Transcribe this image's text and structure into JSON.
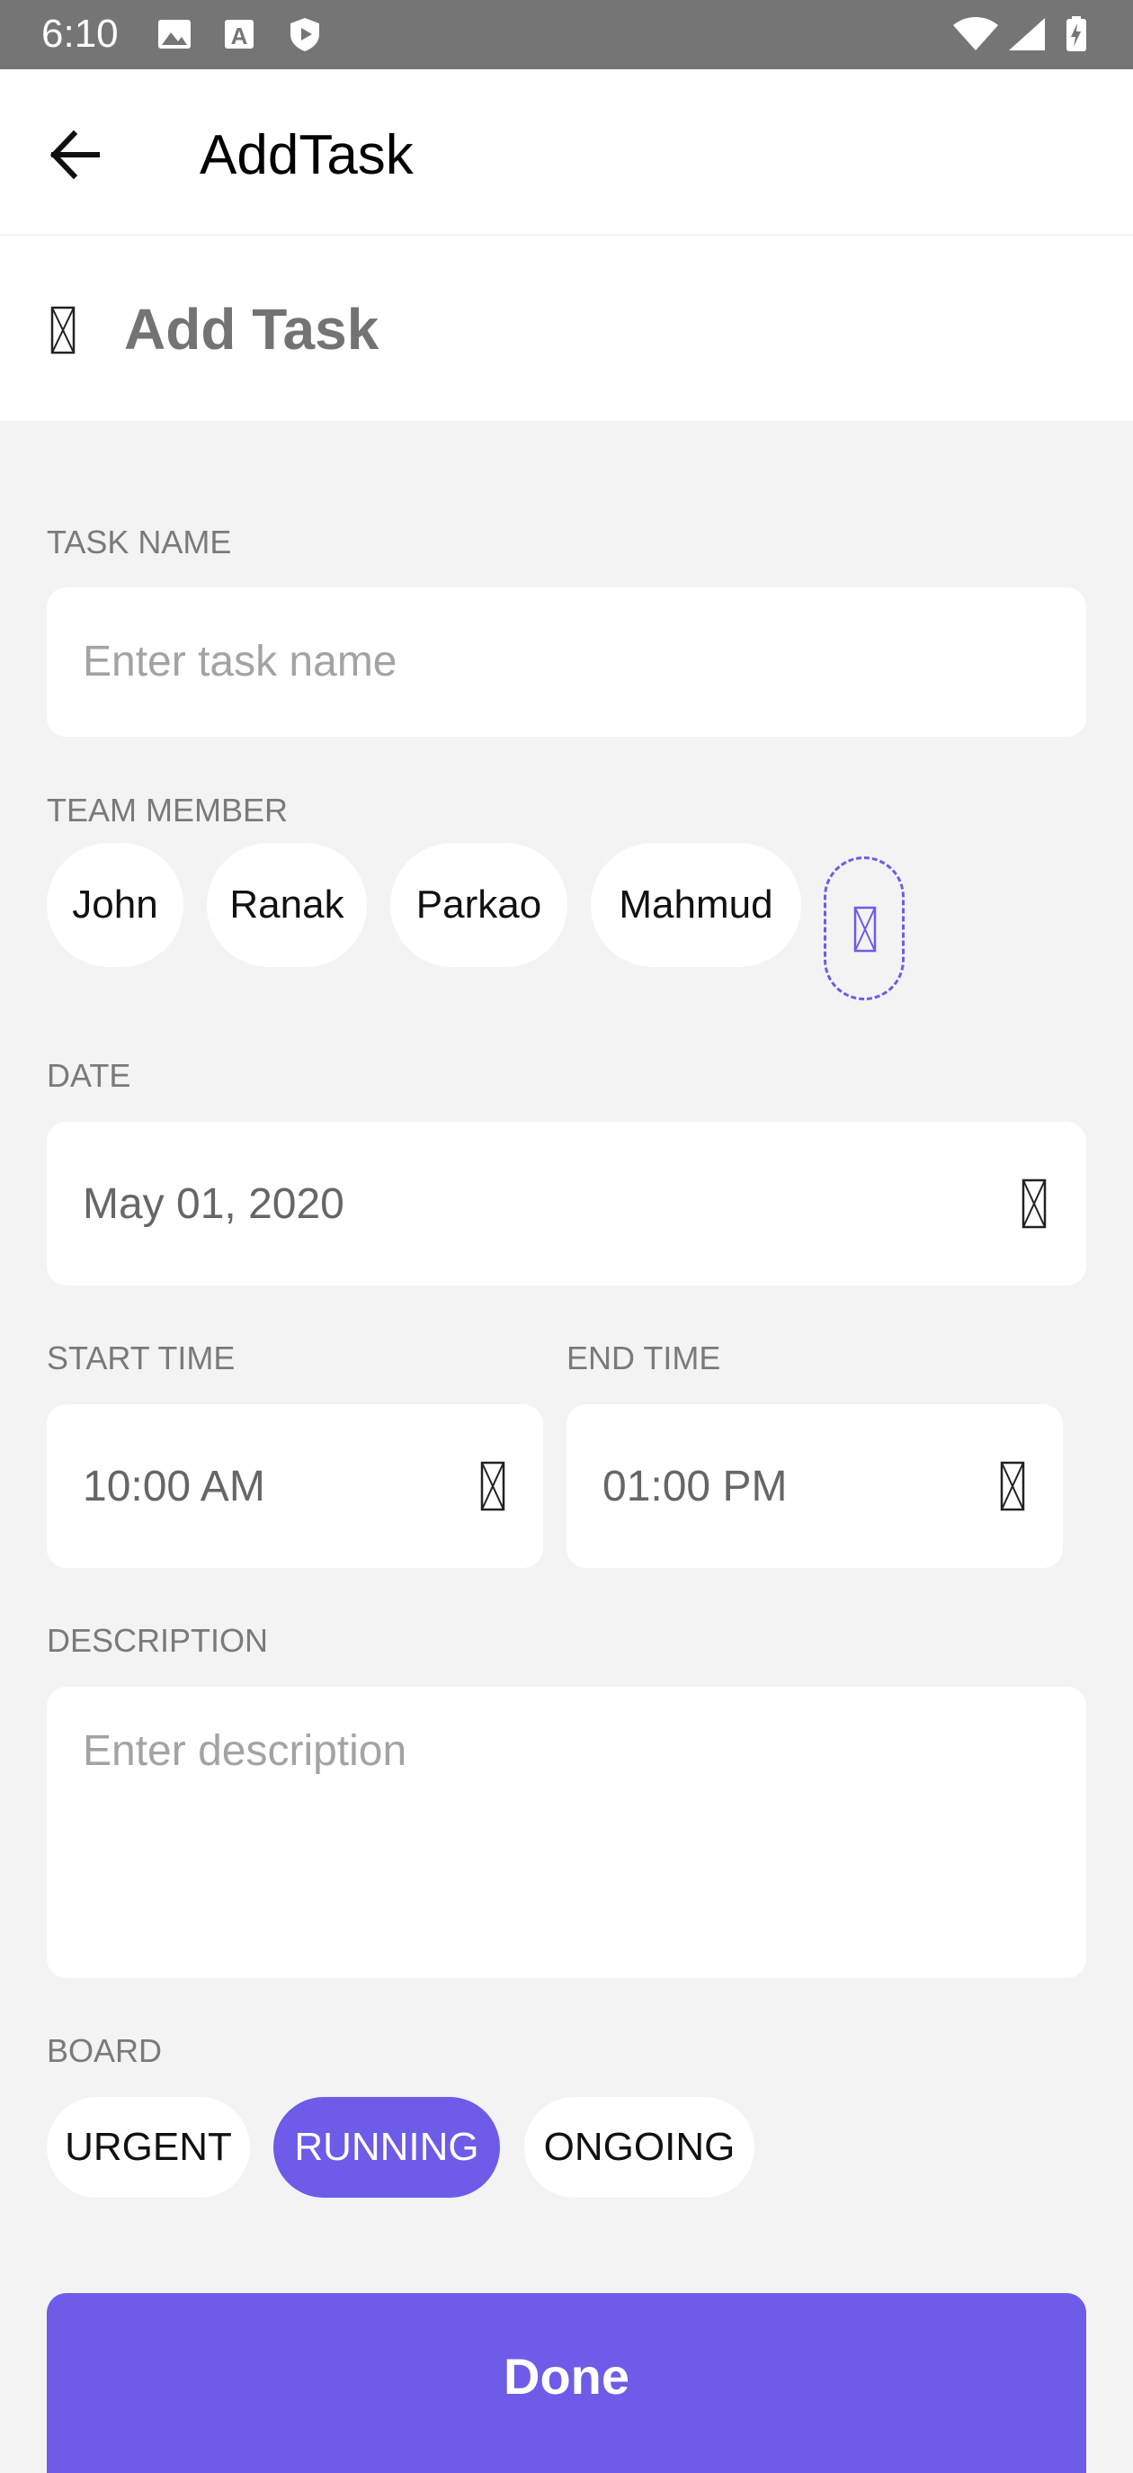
{
  "status_bar": {
    "time": "6:10",
    "icons": [
      "image-icon",
      "a-icon",
      "play-shield-icon",
      "wifi-icon",
      "signal-icon",
      "battery-icon"
    ]
  },
  "app_bar": {
    "title": "AddTask",
    "back_icon": "arrow-back-icon"
  },
  "header": {
    "icon": "missing-glyph-icon",
    "title": "Add Task"
  },
  "task_name": {
    "label": "TASK NAME",
    "placeholder": "Enter task name"
  },
  "team_member": {
    "label": "TEAM MEMBER",
    "members": [
      "John",
      "Ranak",
      "Parkao",
      "Mahmud"
    ],
    "add_icon": "missing-glyph-icon"
  },
  "date": {
    "label": "DATE",
    "value": "May 01, 2020",
    "icon": "missing-glyph-icon"
  },
  "start_time": {
    "label": "START TIME",
    "value": "10:00 AM",
    "icon": "missing-glyph-icon"
  },
  "end_time": {
    "label": "END TIME",
    "value": "01:00 PM",
    "icon": "missing-glyph-icon"
  },
  "description": {
    "label": "DESCRIPTION",
    "placeholder": "Enter description"
  },
  "board": {
    "label": "BOARD",
    "options": [
      "URGENT",
      "RUNNING",
      "ONGOING"
    ],
    "selected": "RUNNING"
  },
  "done_label": "Done",
  "colors": {
    "accent": "#6c5ce7",
    "status_bar": "#757575",
    "background": "#f3f3f4"
  }
}
